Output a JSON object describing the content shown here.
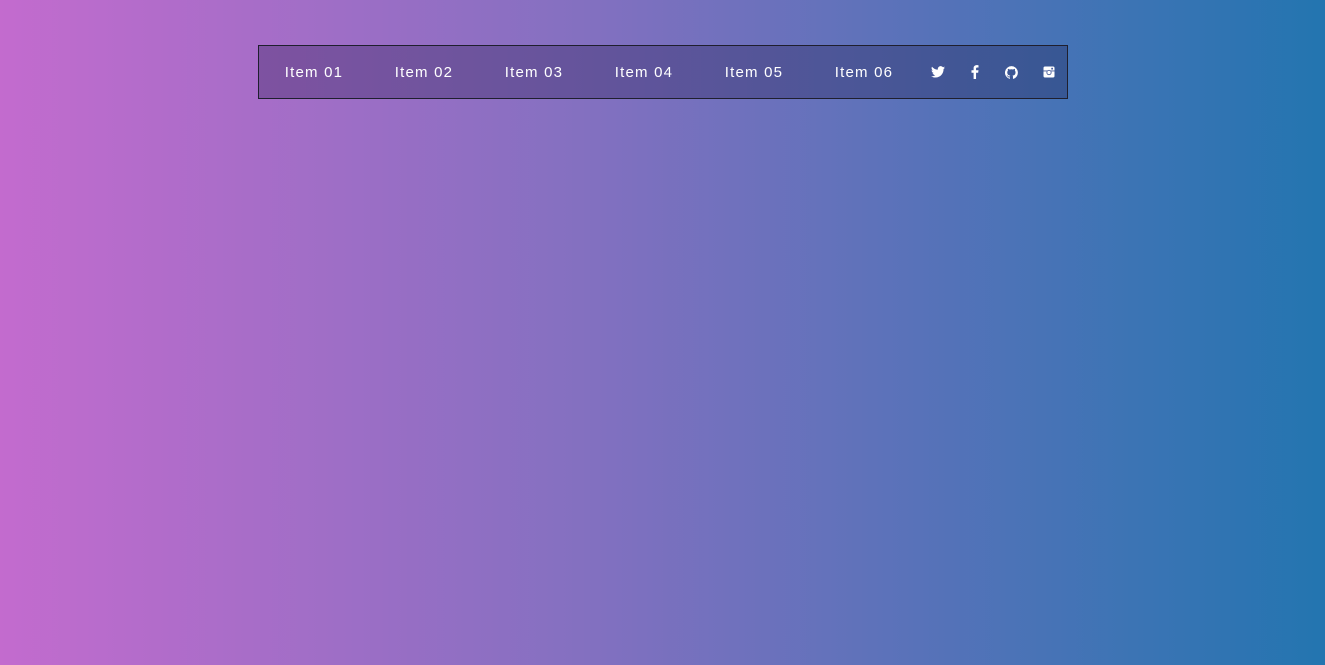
{
  "nav": {
    "items": [
      {
        "label": "Item 01"
      },
      {
        "label": "Item 02"
      },
      {
        "label": "Item 03"
      },
      {
        "label": "Item 04"
      },
      {
        "label": "Item 05"
      },
      {
        "label": "Item 06"
      }
    ],
    "social": [
      {
        "icon": "twitter-icon"
      },
      {
        "icon": "facebook-icon"
      },
      {
        "icon": "github-icon"
      },
      {
        "icon": "instagram-icon"
      }
    ]
  },
  "colors": {
    "background_start": "#c36bce",
    "background_mid": "#8270c0",
    "background_end": "#2375b0",
    "nav_text": "#ffffff",
    "nav_border": "#1f1f2e"
  }
}
